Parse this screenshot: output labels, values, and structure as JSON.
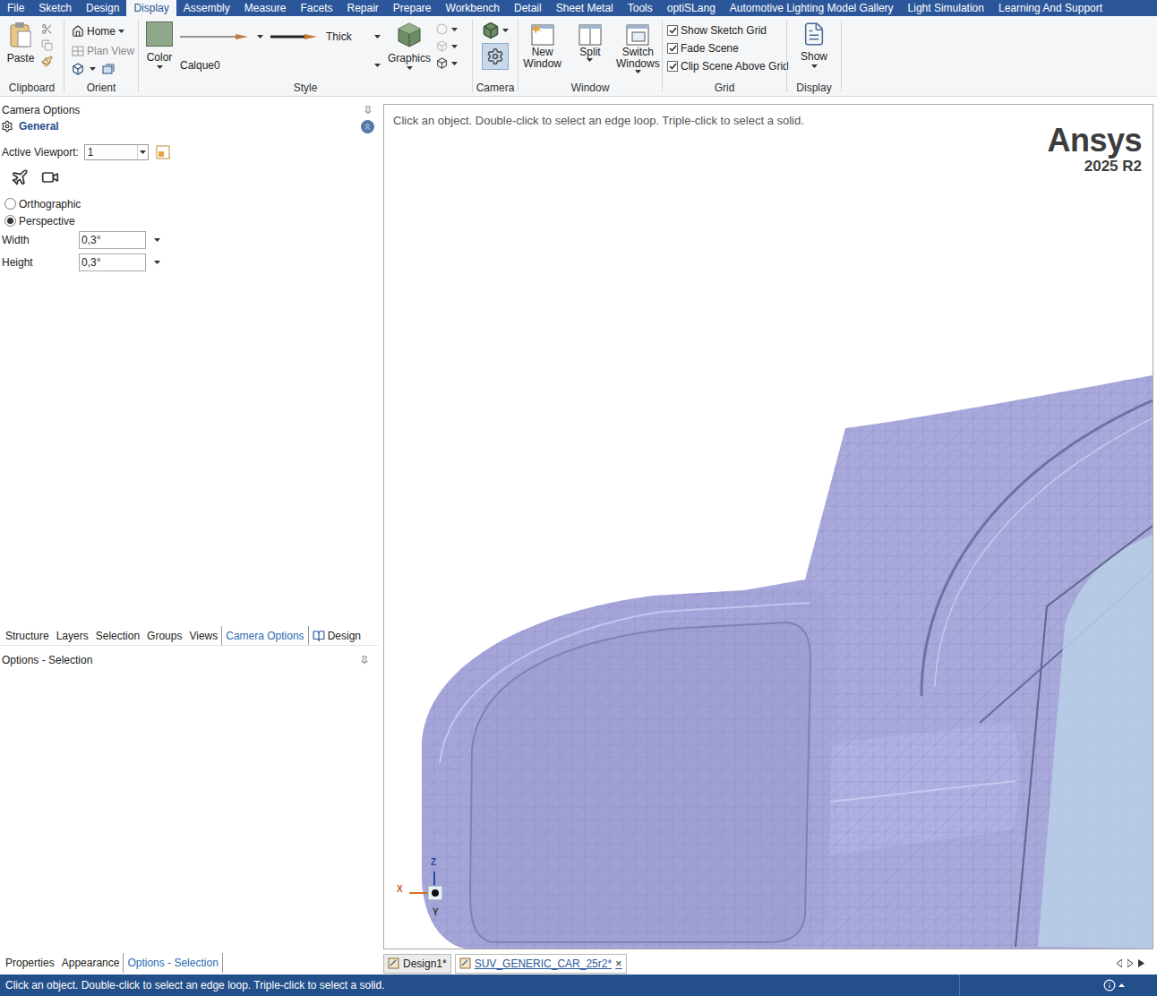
{
  "menu_tabs": [
    {
      "label": "File",
      "selected": false
    },
    {
      "label": "Sketch",
      "selected": false
    },
    {
      "label": "Design",
      "selected": false
    },
    {
      "label": "Display",
      "selected": true
    },
    {
      "label": "Assembly",
      "selected": false
    },
    {
      "label": "Measure",
      "selected": false
    },
    {
      "label": "Facets",
      "selected": false
    },
    {
      "label": "Repair",
      "selected": false
    },
    {
      "label": "Prepare",
      "selected": false
    },
    {
      "label": "Workbench",
      "selected": false
    },
    {
      "label": "Detail",
      "selected": false
    },
    {
      "label": "Sheet Metal",
      "selected": false
    },
    {
      "label": "Tools",
      "selected": false
    },
    {
      "label": "optiSLang",
      "selected": false
    },
    {
      "label": "Automotive Lighting Model Gallery",
      "selected": false
    },
    {
      "label": "Light Simulation",
      "selected": false
    },
    {
      "label": "Learning And Support",
      "selected": false
    }
  ],
  "ribbon": {
    "clipboard": {
      "label": "Clipboard",
      "paste": "Paste"
    },
    "orient": {
      "label": "Orient",
      "home": "Home",
      "plan_view": {
        "label": "Plan View",
        "disabled": true
      }
    },
    "style": {
      "label": "Style",
      "color": "Color",
      "layer": "Calque0",
      "line_weight": "Thick",
      "graphics": "Graphics"
    },
    "camera": {
      "label": "Camera",
      "options_selected": true
    },
    "window": {
      "label": "Window",
      "buttons": [
        "New Window",
        "Split",
        "Switch Windows"
      ]
    },
    "grid": {
      "label": "Grid",
      "options": [
        {
          "label": "Show Sketch Grid",
          "checked": true
        },
        {
          "label": "Fade Scene",
          "checked": true
        },
        {
          "label": "Clip Scene Above Grid",
          "checked": true
        }
      ]
    },
    "display": {
      "label": "Display",
      "show": "Show"
    }
  },
  "left_panel": {
    "title": "Camera Options",
    "section": "General",
    "active_viewport": {
      "label": "Active Viewport:",
      "value": "1"
    },
    "projection": [
      {
        "label": "Orthographic",
        "selected": false
      },
      {
        "label": "Perspective",
        "selected": true
      }
    ],
    "fields": [
      {
        "label": "Width",
        "value": "0,3°"
      },
      {
        "label": "Height",
        "value": "0,3°"
      }
    ]
  },
  "panel_tabs": [
    {
      "label": "Structure",
      "selected": false,
      "kind": "plain"
    },
    {
      "label": "Layers",
      "selected": false,
      "kind": "plain"
    },
    {
      "label": "Selection",
      "selected": false,
      "kind": "plain"
    },
    {
      "label": "Groups",
      "selected": false,
      "kind": "plain"
    },
    {
      "label": "Views",
      "selected": false,
      "kind": "plain"
    },
    {
      "label": "Camera Options",
      "selected": true,
      "kind": "plain"
    },
    {
      "label": "Design",
      "selected": false,
      "kind": "book"
    }
  ],
  "lower_panel": {
    "title": "Options - Selection"
  },
  "bottom_tabs": [
    {
      "label": "Properties",
      "selected": false
    },
    {
      "label": "Appearance",
      "selected": false
    },
    {
      "label": "Options - Selection",
      "selected": true
    }
  ],
  "viewport": {
    "hint": "Click an object. Double-click to select an edge loop. Triple-click to select a solid.",
    "logo": {
      "name": "Ansys",
      "version": "2025 R2"
    },
    "axes": {
      "z": "Z",
      "x": "X",
      "y": "Y"
    }
  },
  "doc_tabs": [
    {
      "label": "Design1*",
      "selected": false,
      "close": ""
    },
    {
      "label": "SUV_GENERIC_CAR_25r2*",
      "selected": true,
      "close": "×"
    }
  ],
  "status_bar": {
    "text": "Click an object. Double-click to select an edge loop. Triple-click to select a solid."
  }
}
